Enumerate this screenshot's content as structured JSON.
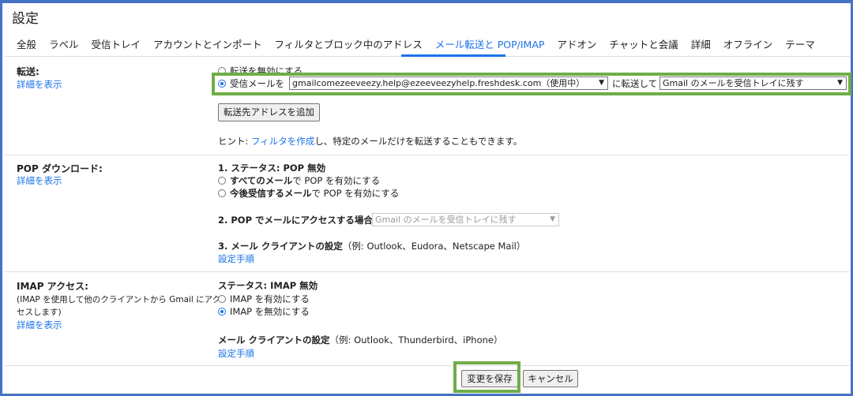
{
  "page": {
    "title": "設定"
  },
  "tabs": [
    {
      "label": "全般"
    },
    {
      "label": "ラベル"
    },
    {
      "label": "受信トレイ"
    },
    {
      "label": "アカウントとインポート"
    },
    {
      "label": "フィルタとブロック中のアドレス"
    },
    {
      "label": "メール転送と POP/IMAP"
    },
    {
      "label": "アドオン"
    },
    {
      "label": "チャットと会議"
    },
    {
      "label": "詳細"
    },
    {
      "label": "オフライン"
    },
    {
      "label": "テーマ"
    }
  ],
  "forwarding": {
    "label": "転送:",
    "detail": "詳細を表示",
    "disable_option": "転送を無効にする",
    "enable_prefix": "受信メールを",
    "address_select": "gmailcomezeeveezy.help@ezeeveezyhelp.freshdesk.com（使用中）",
    "enable_suffix": "に転送して",
    "action_select": "Gmail のメールを受信トレイに残す",
    "add_button": "転送先アドレスを追加",
    "hint_prefix": "ヒント: ",
    "hint_link": "フィルタを作成",
    "hint_suffix": "し、特定のメールだけを転送することもできます。"
  },
  "pop": {
    "label": "POP ダウンロード:",
    "detail": "詳細を表示",
    "status": "1. ステータス: POP 無効",
    "opt1_bold": "すべてのメール",
    "opt1_rest": "で POP を有効にする",
    "opt2_bold": "今後受信するメール",
    "opt2_rest": "で POP を有効にする",
    "access_label": "2. POP でメールにアクセスする場合",
    "access_select": "Gmail のメールを受信トレイに残す",
    "client_title": "3. メール クライアントの設定",
    "client_examples": "（例: Outlook、Eudora、Netscape Mail）",
    "setup_link": "設定手順"
  },
  "imap": {
    "label": "IMAP アクセス:",
    "desc_line1": "(IMAP を使用して他のクライアントから Gmail にアク",
    "desc_line2": "セスします)",
    "detail": "詳細を表示",
    "status": "ステータス: IMAP 無効",
    "enable": "IMAP を有効にする",
    "disable": "IMAP を無効にする",
    "client_title": "メール クライアントの設定",
    "client_examples": "（例: Outlook、Thunderbird、iPhone）",
    "setup_link": "設定手順"
  },
  "footer": {
    "save": "変更を保存",
    "cancel": "キャンセル"
  },
  "colors": {
    "highlight": "#70ad47",
    "frame": "#4472c4",
    "link": "#1a73e8"
  }
}
